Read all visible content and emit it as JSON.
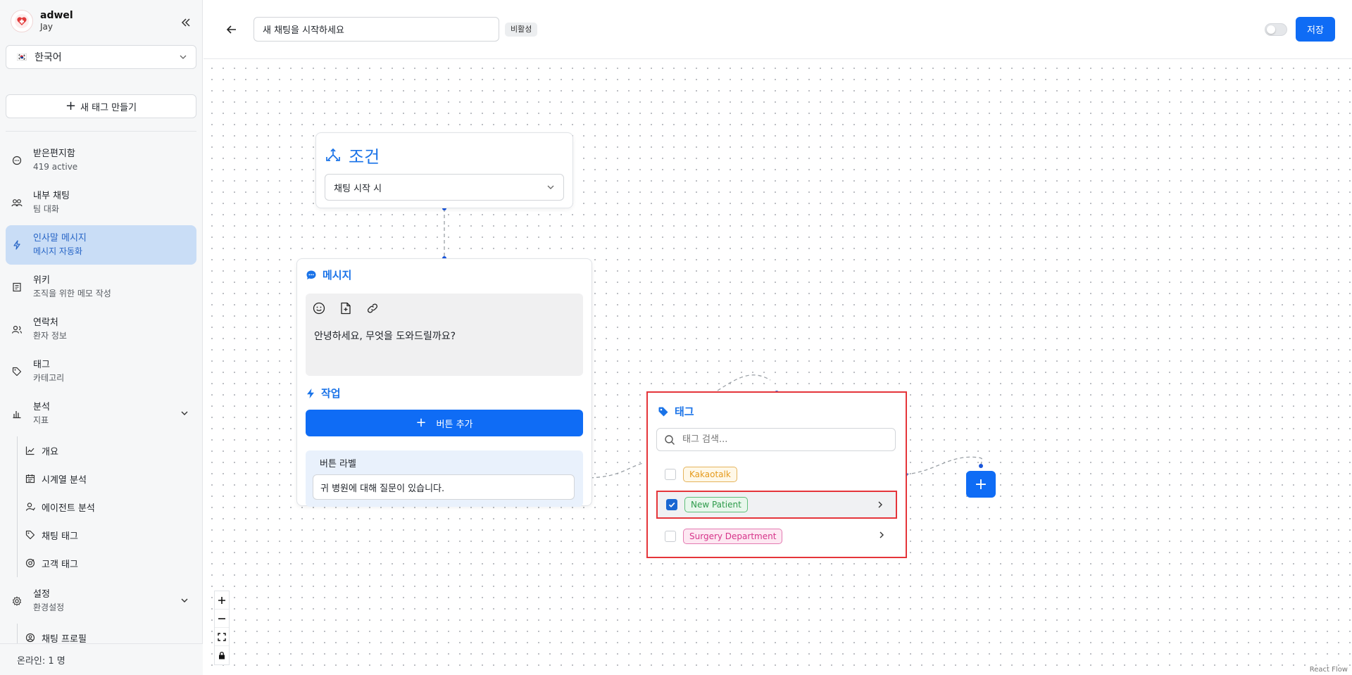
{
  "sidebar": {
    "brand": {
      "name": "adwel",
      "user": "Jay"
    },
    "language": {
      "flag": "🇰🇷",
      "label": "한국어"
    },
    "new_tag_label": "새 태그 만들기",
    "items": [
      {
        "id": "inbox",
        "title": "받은편지함",
        "sub": "419 active",
        "icon": "chat-bubble-icon"
      },
      {
        "id": "internal-chat",
        "title": "내부 채팅",
        "sub": "팀 대화",
        "icon": "users-icon"
      },
      {
        "id": "greeting",
        "title": "인사말 메시지",
        "sub": "메시지 자동화",
        "icon": "lightning-icon",
        "active": true
      },
      {
        "id": "wiki",
        "title": "위키",
        "sub": "조직을 위한 메모 작성",
        "icon": "book-icon"
      },
      {
        "id": "contacts",
        "title": "연락처",
        "sub": "환자 정보",
        "icon": "contacts-icon"
      },
      {
        "id": "tags",
        "title": "태그",
        "sub": "카테고리",
        "icon": "tag-icon"
      },
      {
        "id": "analytics",
        "title": "분석",
        "sub": "지표",
        "icon": "bar-chart-icon",
        "expanded": true
      }
    ],
    "analytics_sub": [
      {
        "label": "개요",
        "icon": "line-chart-icon"
      },
      {
        "label": "시계열 분석",
        "icon": "calendar-icon"
      },
      {
        "label": "에이전트 분석",
        "icon": "agent-icon"
      },
      {
        "label": "채팅 태그",
        "icon": "tag-icon"
      },
      {
        "label": "고객 태그",
        "icon": "customer-tag-icon"
      }
    ],
    "settings": {
      "title": "설정",
      "sub": "환경설정",
      "icon": "gear-icon"
    },
    "settings_sub": [
      {
        "label": "채팅 프로필",
        "icon": "profile-icon"
      }
    ],
    "footer": "온라인: 1 명"
  },
  "header": {
    "title_value": "새 채팅을 시작하세요",
    "status_badge": "비활성",
    "save_label": "저장",
    "toggle_on": false
  },
  "canvas": {
    "condition": {
      "title": "조건",
      "select_value": "채팅 시작 시"
    },
    "message": {
      "title": "메시지",
      "text": "안녕하세요, 무엇을 도와드릴까요?",
      "action_title": "작업",
      "add_button": "버튼 추가",
      "button_label_title": "버튼 라벨",
      "button_label_value": "귀 병원에 대해 질문이 있습니다."
    },
    "tag": {
      "title": "태그",
      "search_placeholder": "태그 검색...",
      "options": [
        {
          "label": "Kakaotalk",
          "checked": false,
          "color": "#e59a1c",
          "bg": "#fff8e8",
          "chevron": false
        },
        {
          "label": "New Patient",
          "checked": true,
          "color": "#2d9b4a",
          "bg": "#e8f7ec",
          "chevron": true,
          "selected": true
        },
        {
          "label": "Surgery Department",
          "checked": false,
          "color": "#d6338a",
          "bg": "#fde8f2",
          "chevron": true
        }
      ]
    },
    "attribution": "React Flow"
  },
  "colors": {
    "accent": "#0f6cf5",
    "active_nav": "#c9ddf6",
    "highlight_border": "#e5353a"
  }
}
